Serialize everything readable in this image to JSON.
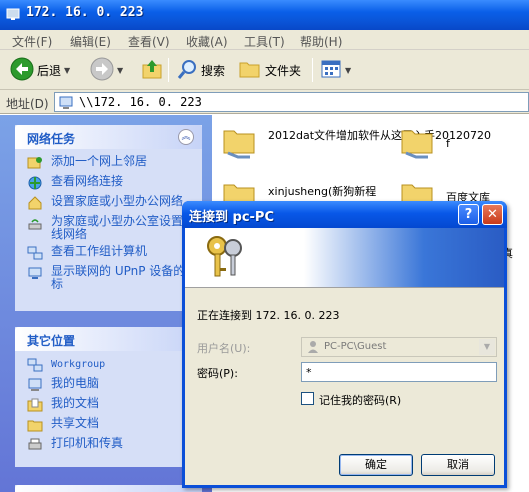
{
  "window": {
    "title": "172. 16. 0. 223"
  },
  "menu": [
    {
      "label": "文件(F)"
    },
    {
      "label": "编辑(E)"
    },
    {
      "label": "查看(V)"
    },
    {
      "label": "收藏(A)"
    },
    {
      "label": "工具(T)"
    },
    {
      "label": "帮助(H)"
    }
  ],
  "toolbar": {
    "back_label": "后退",
    "search_label": "搜索",
    "folders_label": "文件夹"
  },
  "address": {
    "label": "地址(D)",
    "value": "\\\\172. 16. 0. 223"
  },
  "network_tasks": {
    "title": "网络任务",
    "items": [
      {
        "label": "添加一个网上邻居"
      },
      {
        "label": "查看网络连接"
      },
      {
        "label": "设置家庭或小型办公网络"
      },
      {
        "label": "为家庭或小型办公室设置无线网络"
      },
      {
        "label": "查看工作组计算机"
      },
      {
        "label": "显示联网的 UPnP 设备的图标"
      }
    ]
  },
  "other_places": {
    "title": "其它位置",
    "items": [
      {
        "label": "Workgroup"
      },
      {
        "label": "我的电脑"
      },
      {
        "label": "我的文档"
      },
      {
        "label": "共享文档"
      },
      {
        "label": "打印机和传真"
      }
    ]
  },
  "files": [
    {
      "name": "2012dat文件增加软件从这里入手20120720"
    },
    {
      "name": "f"
    },
    {
      "name": "xinjusheng(新狗新程"
    },
    {
      "name": "百度文库"
    },
    {
      "name": "真"
    }
  ],
  "dialog": {
    "title": "连接到 pc-PC",
    "help": "?",
    "close": "✕",
    "connecting_text": "正在连接到 172. 16. 0. 223",
    "username_label": "用户名(U):",
    "username_value": "PC-PC\\Guest",
    "password_label": "密码(P):",
    "password_value": "*",
    "remember_label": "记住我的密码(R)",
    "ok_label": "确定",
    "cancel_label": "取消"
  },
  "colors": {
    "title_blue": "#0a5fe8",
    "link_blue": "#215dc6",
    "dialog_close_red": "#c83a1a"
  }
}
